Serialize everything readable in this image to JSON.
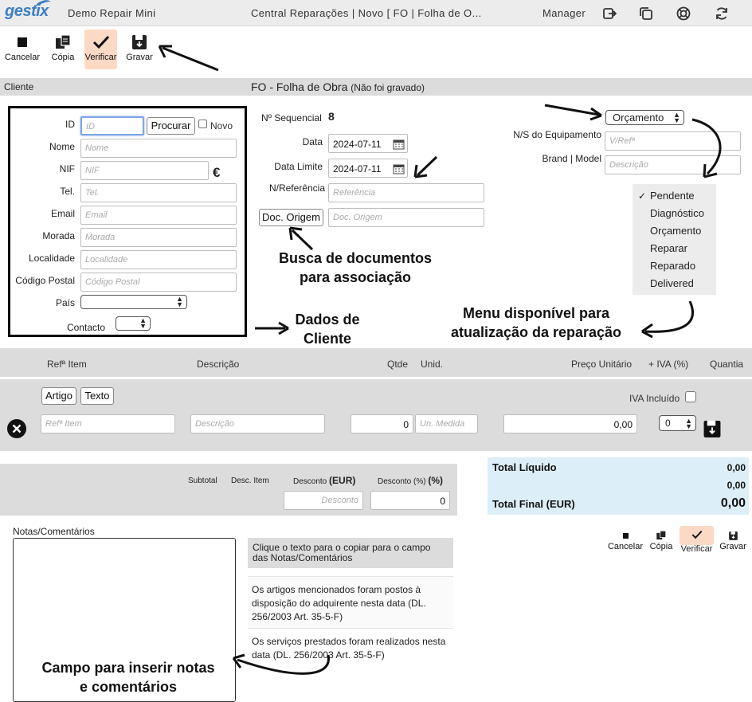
{
  "topbar": {
    "logo": "gestix",
    "app_name": "Demo Repair Mini",
    "doc_title": "Central Reparações | Novo [ FO | Folha de O...",
    "user": "Manager"
  },
  "toolbar": {
    "cancel": "Cancelar",
    "copy": "Cópia",
    "verify": "Verificar",
    "save": "Gravar"
  },
  "section": {
    "client_label": "Cliente",
    "doc_title": "FO - Folha de Obra",
    "doc_status": "(Não foi gravado)"
  },
  "client": {
    "id_label": "ID",
    "id_placeholder": "ID",
    "search_button": "Procurar",
    "new_label": "Novo",
    "name_label": "Nome",
    "name_placeholder": "Nome",
    "nif_label": "NIF",
    "nif_placeholder": "NIF",
    "euro": "€",
    "tel_label": "Tel.",
    "tel_placeholder": "Tel.",
    "email_label": "Email",
    "email_placeholder": "Email",
    "address_label": "Morada",
    "address_placeholder": "Morada",
    "city_label": "Localidade",
    "city_placeholder": "Localidade",
    "postal_label": "Código Postal",
    "postal_placeholder": "Código Postal",
    "country_label": "País",
    "contact_label": "Contacto"
  },
  "doc": {
    "seq_label": "Nº Sequencial",
    "seq_value": "8",
    "date_label": "Data",
    "date_value": "2024-07-11",
    "limit_label": "Data Limite",
    "limit_value": "2024-07-11",
    "ref_label": "N/Referência",
    "ref_placeholder": "Referência",
    "origin_button": "Doc. Origem",
    "origin_placeholder": "Doc. Origem"
  },
  "equipment": {
    "status_select": "Orçamento",
    "serial_label": "N/S do Equipamento",
    "serial_placeholder": "V/Refª",
    "brand_label": "Brand | Model",
    "brand_placeholder": "Descrição"
  },
  "status_menu": {
    "checked": "✓",
    "items": [
      "Pendente",
      "Diagnóstico",
      "Orçamento",
      "Reparar",
      "Reparado",
      "Delivered"
    ]
  },
  "annotations": {
    "search_docs": "Busca de documentos\npara associação",
    "client_data": "Dados de\nCliente",
    "menu_update": "Menu disponível para\natualização da reparação",
    "notes_field": "Campo para inserir notas\ne comentários"
  },
  "lines_header": {
    "ref": "Refª Item",
    "desc": "Descrição",
    "qty": "Qtde",
    "unit": "Unid.",
    "price": "Preço Unitário",
    "vat": "+ IVA (%)",
    "amount": "Quantia"
  },
  "line_entry": {
    "article_button": "Artigo",
    "text_button": "Texto",
    "vat_included": "IVA Incluído",
    "ref_placeholder": "Refª Item",
    "desc_placeholder": "Descrição",
    "qty_value": "0",
    "unit_placeholder": "Un. Medida",
    "price_value": "0,00",
    "vat_value": "0"
  },
  "discounts": {
    "subtotal": "Subtotal",
    "item_discount": "Desc. Item",
    "discount_label": "Desconto",
    "discount_unit": "(EUR)",
    "discount_pct_label": "Desconto (%)",
    "discount_pct_unit": "(%)",
    "discount_placeholder": "Desconto",
    "discount_pct_value": "0"
  },
  "totals": {
    "net_label": "Total Líquido",
    "net_value": "0,00",
    "vat_value": "0,00",
    "final_label": "Total Final (EUR)",
    "final_value": "0,00"
  },
  "notes": {
    "label": "Notas/Comentários",
    "hint": "Clique o texto para o copiar para o campo das Notas/Comentários",
    "snippets": [
      "Os artigos mencionados foram postos à disposição do adquirente nesta data (DL. 256/2003 Art. 35-5-F)",
      "Os serviços prestados foram realizados nesta data (DL. 256/2003 Art. 35-5-F)"
    ]
  }
}
